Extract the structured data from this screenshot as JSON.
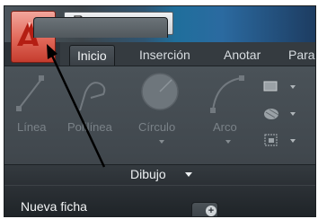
{
  "app_menu": {
    "icon": "autocad-logo-icon"
  },
  "quick_access": {
    "icons": [
      "new-file-icon",
      "open-folder-icon",
      "save-icon",
      "customize-caret-icon"
    ]
  },
  "ribbon_tabs": [
    {
      "label": "Inicio",
      "active": true
    },
    {
      "label": "Inserción",
      "active": false
    },
    {
      "label": "Anotar",
      "active": false
    },
    {
      "label": "Parar",
      "active": false
    }
  ],
  "draw_panel": {
    "title": "Dibujo",
    "tools": [
      {
        "label": "Línea",
        "icon": "line-icon"
      },
      {
        "label": "Polilínea",
        "icon": "polyline-icon"
      },
      {
        "label": "Círculo",
        "icon": "circle-icon"
      },
      {
        "label": "Arco",
        "icon": "arc-icon"
      }
    ],
    "small_tools": [
      "rectangle-icon",
      "hatch-icon",
      "gradient-icon"
    ]
  },
  "doc_tabs": [
    {
      "label": "Nueva ficha"
    }
  ],
  "colors": {
    "accent_red": "#d64a3a",
    "annotation_arrow": "#000000"
  }
}
